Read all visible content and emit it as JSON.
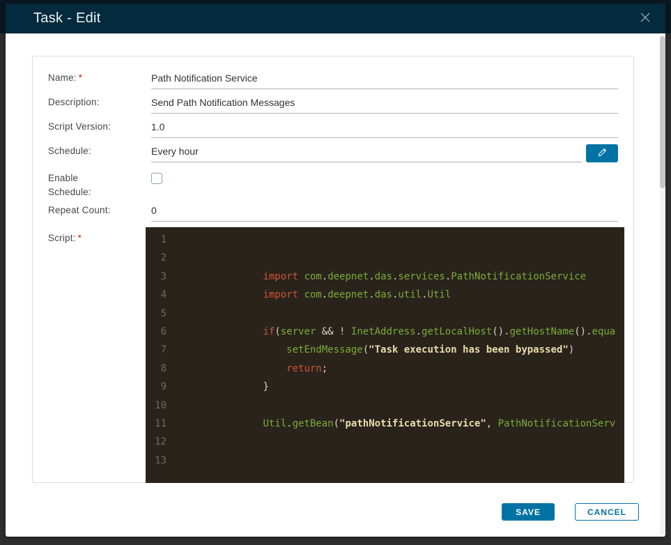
{
  "modal": {
    "title": "Task - Edit"
  },
  "form": {
    "name": {
      "label": "Name:",
      "required_marker": "*",
      "value": "Path Notification Service"
    },
    "description": {
      "label": "Description:",
      "value": "Send Path Notification Messages"
    },
    "script_version": {
      "label": "Script Version:",
      "value": "1.0"
    },
    "schedule": {
      "label": "Schedule:",
      "value": "Every hour"
    },
    "enable_schedule": {
      "label_line1": "Enable",
      "label_line2": "Schedule:",
      "checked": false
    },
    "repeat_count": {
      "label": "Repeat Count:",
      "value": "0"
    },
    "script": {
      "label": "Script:",
      "required_marker": "*"
    }
  },
  "editor": {
    "lines": [
      {
        "n": "1",
        "tokens": []
      },
      {
        "n": "2",
        "tokens": []
      },
      {
        "n": "3",
        "tokens": [
          {
            "c": "pl",
            "t": "               "
          },
          {
            "c": "kw",
            "t": "import"
          },
          {
            "c": "pl",
            "t": " "
          },
          {
            "c": "id",
            "t": "com"
          },
          {
            "c": "pl",
            "t": "."
          },
          {
            "c": "id",
            "t": "deepnet"
          },
          {
            "c": "pl",
            "t": "."
          },
          {
            "c": "id",
            "t": "das"
          },
          {
            "c": "pl",
            "t": "."
          },
          {
            "c": "id",
            "t": "services"
          },
          {
            "c": "pl",
            "t": "."
          },
          {
            "c": "id",
            "t": "PathNotificationService"
          }
        ]
      },
      {
        "n": "4",
        "tokens": [
          {
            "c": "pl",
            "t": "               "
          },
          {
            "c": "kw",
            "t": "import"
          },
          {
            "c": "pl",
            "t": " "
          },
          {
            "c": "id",
            "t": "com"
          },
          {
            "c": "pl",
            "t": "."
          },
          {
            "c": "id",
            "t": "deepnet"
          },
          {
            "c": "pl",
            "t": "."
          },
          {
            "c": "id",
            "t": "das"
          },
          {
            "c": "pl",
            "t": "."
          },
          {
            "c": "id",
            "t": "util"
          },
          {
            "c": "pl",
            "t": "."
          },
          {
            "c": "id",
            "t": "Util"
          }
        ]
      },
      {
        "n": "5",
        "tokens": []
      },
      {
        "n": "6",
        "tokens": [
          {
            "c": "pl",
            "t": "               "
          },
          {
            "c": "kw",
            "t": "if"
          },
          {
            "c": "pl",
            "t": "("
          },
          {
            "c": "id",
            "t": "server"
          },
          {
            "c": "pl",
            "t": " && ! "
          },
          {
            "c": "id",
            "t": "InetAddress"
          },
          {
            "c": "pl",
            "t": "."
          },
          {
            "c": "id",
            "t": "getLocalHost"
          },
          {
            "c": "pl",
            "t": "()."
          },
          {
            "c": "id",
            "t": "getHostName"
          },
          {
            "c": "pl",
            "t": "()."
          },
          {
            "c": "id",
            "t": "equa"
          }
        ]
      },
      {
        "n": "7",
        "tokens": [
          {
            "c": "pl",
            "t": "                   "
          },
          {
            "c": "id",
            "t": "setEndMessage"
          },
          {
            "c": "pl",
            "t": "("
          },
          {
            "c": "str",
            "t": "\"Task execution has been bypassed\""
          },
          {
            "c": "pl",
            "t": ")"
          }
        ]
      },
      {
        "n": "8",
        "tokens": [
          {
            "c": "pl",
            "t": "                   "
          },
          {
            "c": "kw",
            "t": "return"
          },
          {
            "c": "pl",
            "t": ";"
          }
        ]
      },
      {
        "n": "9",
        "tokens": [
          {
            "c": "pl",
            "t": "               "
          },
          {
            "c": "pl",
            "t": "}"
          }
        ]
      },
      {
        "n": "10",
        "tokens": []
      },
      {
        "n": "11",
        "tokens": [
          {
            "c": "pl",
            "t": "               "
          },
          {
            "c": "id",
            "t": "Util"
          },
          {
            "c": "pl",
            "t": "."
          },
          {
            "c": "id",
            "t": "getBean"
          },
          {
            "c": "pl",
            "t": "("
          },
          {
            "c": "str",
            "t": "\"pathNotificationService\""
          },
          {
            "c": "pl",
            "t": ", "
          },
          {
            "c": "id",
            "t": "PathNotificationServ"
          }
        ]
      },
      {
        "n": "12",
        "tokens": []
      },
      {
        "n": "13",
        "tokens": []
      }
    ]
  },
  "footer": {
    "save": "SAVE",
    "cancel": "CANCEL"
  },
  "colors": {
    "header_bg": "#042a3d",
    "primary_blue": "#0072a3",
    "required_red": "#c92100",
    "editor_bg": "#2a231c",
    "token_keyword": "#cd5532",
    "token_identifier": "#79ad35",
    "token_string": "#e9dcab",
    "token_plain": "#d8d2c6"
  }
}
